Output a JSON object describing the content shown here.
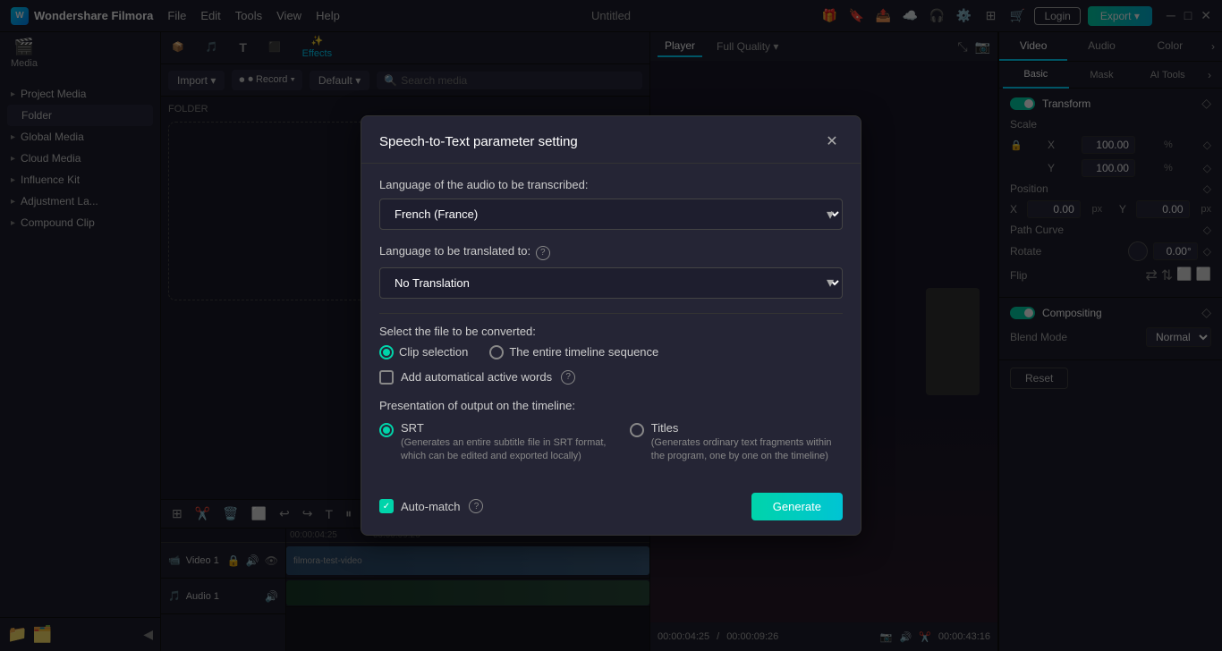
{
  "app": {
    "name": "Wondershare Filmora",
    "title": "Untitled",
    "login_label": "Login",
    "export_label": "Export ▾"
  },
  "menu": {
    "items": [
      "File",
      "Edit",
      "Tools",
      "View",
      "Help"
    ]
  },
  "nav": {
    "items": [
      {
        "id": "media",
        "label": "Media",
        "icon": "🎬"
      },
      {
        "id": "stock_media",
        "label": "Stock Media",
        "icon": "📦"
      },
      {
        "id": "audio",
        "label": "Audio",
        "icon": "🎵"
      },
      {
        "id": "titles",
        "label": "Titles",
        "icon": "T"
      },
      {
        "id": "transitions",
        "label": "Transitions",
        "icon": "⬛"
      },
      {
        "id": "effects",
        "label": "Effects",
        "icon": "✨",
        "active": true
      }
    ]
  },
  "sidebar": {
    "items": [
      {
        "label": "Project Media",
        "arrow": "▸"
      },
      {
        "label": "Folder",
        "active": true
      },
      {
        "label": "Global Media",
        "arrow": "▸"
      },
      {
        "label": "Cloud Media",
        "arrow": "▸"
      },
      {
        "label": "Influence Kit",
        "arrow": "▸"
      },
      {
        "label": "Adjustment La...",
        "arrow": "▸"
      },
      {
        "label": "Compound Clip",
        "arrow": "▸"
      }
    ],
    "folder_label": "FOLDER"
  },
  "toolbar": {
    "import_label": "Import ▾",
    "default_label": "Default ▾",
    "record_label": "⏺ Record ▾",
    "search_placeholder": "Search media"
  },
  "player": {
    "tabs": [
      "Player",
      "Full Quality ▾"
    ],
    "icons": [
      "📷",
      "🔊",
      "✂️"
    ],
    "time": "00:00:04:25",
    "total": "00:00:09:26",
    "end_time": "00:00:43:16"
  },
  "right_panel": {
    "tabs": [
      "Video",
      "Audio",
      "Color"
    ],
    "sub_tabs": [
      "Basic",
      "Mask",
      "AI Tools"
    ],
    "transform_label": "Transform",
    "transform_toggle": true,
    "scale_label": "Scale",
    "x_label": "X",
    "y_label": "Y",
    "scale_x": "100.00",
    "scale_y": "100.00",
    "scale_unit": "%",
    "position_label": "Position",
    "pos_x": "0.00",
    "pos_y": "0.00",
    "pos_unit": "px",
    "path_curve_label": "Path Curve",
    "rotate_label": "Rotate",
    "rotate_value": "0.00°",
    "flip_label": "Flip",
    "compositing_label": "Compositing",
    "compositing_toggle": true,
    "blend_mode_label": "Blend Mode",
    "blend_mode_value": "Normal",
    "reset_label": "Reset"
  },
  "timeline": {
    "video_track_label": "Video 1",
    "audio_track_label": "Audio 1",
    "clip_name": "filmora-test-video",
    "time_markers": [
      "00:00:04:25",
      "00:00:09:26"
    ]
  },
  "modal": {
    "title": "Speech-to-Text parameter setting",
    "close_icon": "✕",
    "audio_lang_label": "Language of the audio to be transcribed:",
    "audio_lang_value": "French (France)",
    "translate_label": "Language to be translated to:",
    "translate_value": "No Translation",
    "file_convert_label": "Select the file to be converted:",
    "clip_selection_label": "Clip selection",
    "entire_timeline_label": "The entire timeline sequence",
    "auto_active_label": "Add automatical active words",
    "output_label": "Presentation of output on the timeline:",
    "srt_label": "SRT",
    "srt_desc": "(Generates an entire subtitle file in SRT format, which can be edited and exported locally)",
    "titles_label": "Titles",
    "titles_desc": "(Generates ordinary text fragments within the program, one by one on the timeline)",
    "auto_match_label": "Auto-match",
    "generate_label": "Generate",
    "clip_selection_checked": true,
    "srt_checked": true,
    "auto_match_checked": true
  }
}
